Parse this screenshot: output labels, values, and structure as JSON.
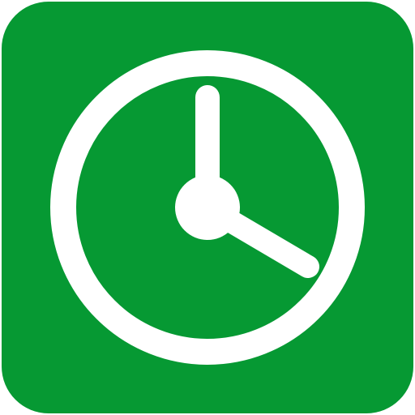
{
  "icon": {
    "name": "clock-icon",
    "background_color": "#069933",
    "foreground_color": "#FFFFFF"
  }
}
